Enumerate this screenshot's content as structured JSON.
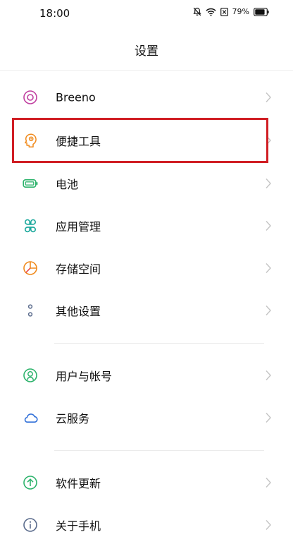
{
  "status_bar": {
    "time": "18:00",
    "battery_percent": "79%",
    "icons": [
      "mute-icon",
      "wifi-icon",
      "sim-icon",
      "battery-icon"
    ]
  },
  "header": {
    "title": "设置"
  },
  "groups": [
    {
      "items": [
        {
          "label": "Breeno",
          "icon": "breeno-icon",
          "color": "#c040a0"
        },
        {
          "label": "便捷工具",
          "icon": "convenience-tools-icon",
          "color": "#f08a1c",
          "highlighted": true
        },
        {
          "label": "电池",
          "icon": "battery-icon",
          "color": "#2db36c"
        },
        {
          "label": "应用管理",
          "icon": "app-management-icon",
          "color": "#1aa89c"
        },
        {
          "label": "存储空间",
          "icon": "storage-icon",
          "color": "#f08a1c"
        },
        {
          "label": "其他设置",
          "icon": "other-settings-icon",
          "color": "#5a6b8c"
        }
      ]
    },
    {
      "items": [
        {
          "label": "用户与帐号",
          "icon": "user-account-icon",
          "color": "#2db36c"
        },
        {
          "label": "云服务",
          "icon": "cloud-icon",
          "color": "#2f6fd8"
        }
      ]
    },
    {
      "items": [
        {
          "label": "软件更新",
          "icon": "software-update-icon",
          "color": "#2db36c"
        },
        {
          "label": "关于手机",
          "icon": "about-phone-icon",
          "color": "#5a6b8c"
        }
      ]
    }
  ],
  "highlight_color": "#d01e24"
}
